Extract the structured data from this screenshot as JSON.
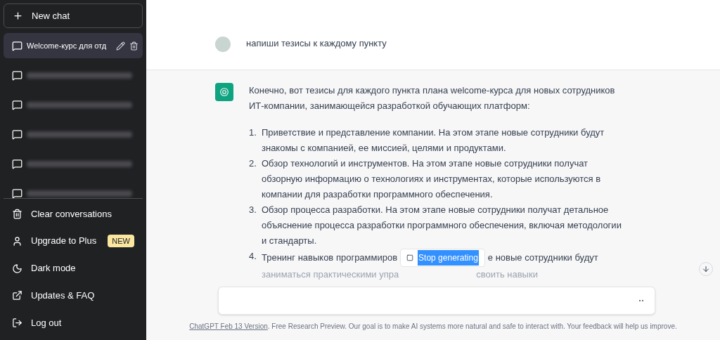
{
  "sidebar": {
    "new_chat": "New chat",
    "chats": [
      {
        "title": "Welcome-курс для отд",
        "selected": true,
        "blurred": false
      },
      {
        "selected": false,
        "blurred": true
      },
      {
        "selected": false,
        "blurred": true
      },
      {
        "selected": false,
        "blurred": true
      },
      {
        "selected": false,
        "blurred": true
      },
      {
        "selected": false,
        "blurred": true
      }
    ],
    "menu": [
      {
        "kind": "trash",
        "label": "Clear conversations"
      },
      {
        "kind": "user",
        "label": "Upgrade to Plus",
        "badge": "NEW"
      },
      {
        "kind": "moon",
        "label": "Dark mode"
      },
      {
        "kind": "external",
        "label": "Updates & FAQ"
      },
      {
        "kind": "logout",
        "label": "Log out"
      }
    ]
  },
  "conversation": {
    "user_message": "напиши тезисы к каждому пункту",
    "assistant_intro": "Конечно, вот тезисы для каждого пункта плана welcome-курса для новых сотрудников ИТ-компании, занимающейся разработкой обучающих платформ:",
    "items": [
      {
        "number": "1.",
        "text": "Приветствие и представление компании. На этом этапе новые сотрудники будут знакомы с компанией, ее миссией, целями и продуктами."
      },
      {
        "number": "2.",
        "text": "Обзор технологий и инструментов. На этом этапе новые сотрудники получат обзорную информацию о технологиях и инструментах, которые используются в компании для разработки программного обеспечения."
      },
      {
        "number": "3.",
        "text": "Обзор процесса разработки. На этом этапе новые сотрудники получат детальное объяснение процесса разработки программного обеспечения, включая методологии и стандарты."
      }
    ],
    "covered_item": {
      "number": "4.",
      "line_1": [
        "Тренинг навыков программиров",
        "е новые сотрудники будут"
      ],
      "line_2": [
        "заниматься практическими упра",
        "своить навыки"
      ]
    }
  },
  "stop_button": {
    "label": "Stop generating",
    "selected": true
  },
  "footer": {
    "link": "ChatGPT Feb 13 Version",
    "text": ". Free Research Preview. Our goal is to make AI systems more natural and safe to interact with. Your feedback will help us improve."
  }
}
